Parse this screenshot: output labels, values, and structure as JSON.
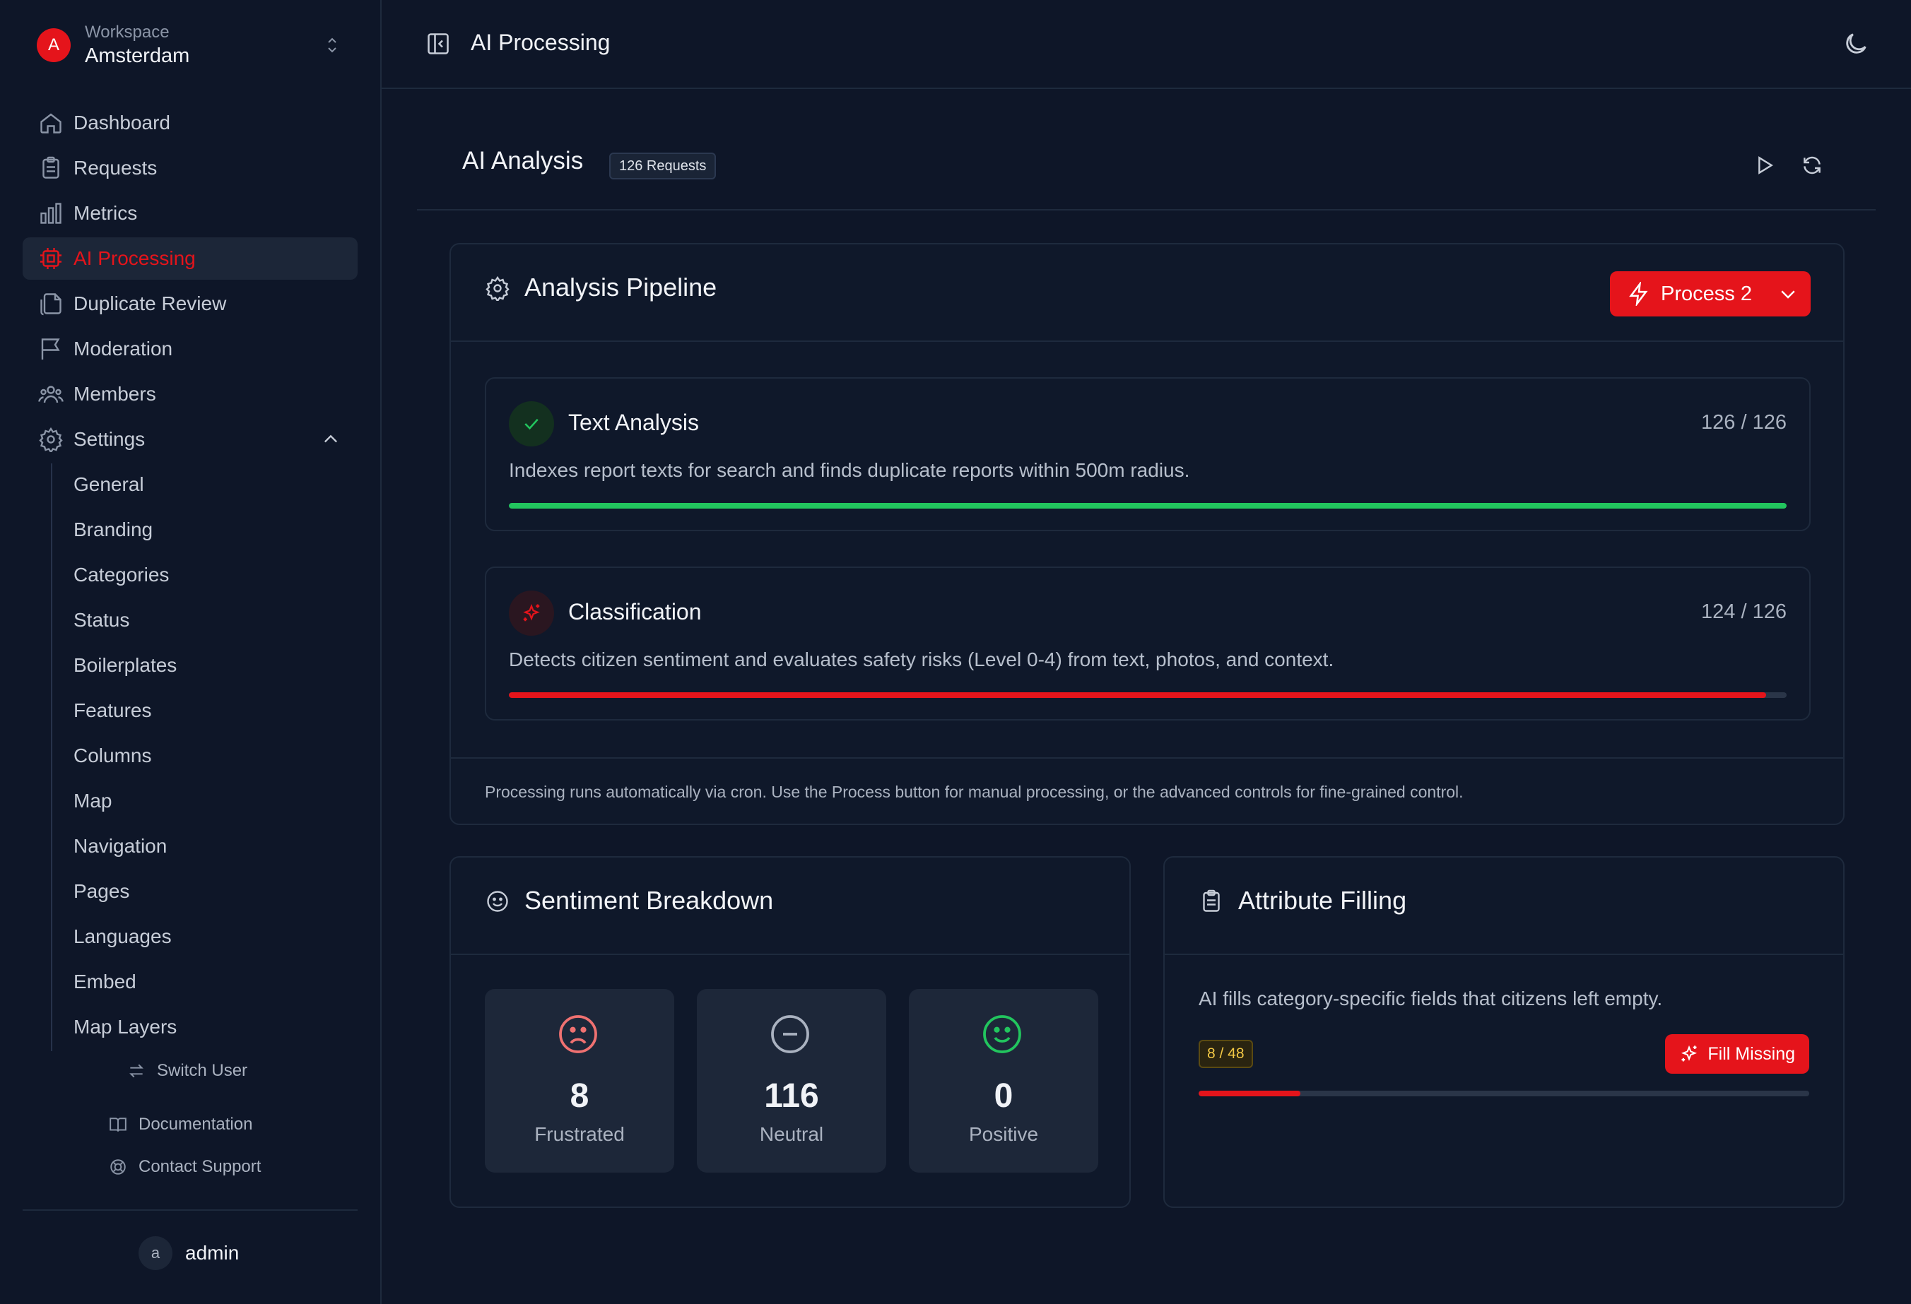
{
  "workspace": {
    "label": "Workspace",
    "name": "Amsterdam",
    "initial": "A"
  },
  "nav": {
    "dashboard": "Dashboard",
    "requests": "Requests",
    "metrics": "Metrics",
    "ai_processing": "AI Processing",
    "duplicate_review": "Duplicate Review",
    "moderation": "Moderation",
    "members": "Members",
    "settings": "Settings"
  },
  "settings_sub": [
    "General",
    "Branding",
    "Categories",
    "Status",
    "Boilerplates",
    "Features",
    "Columns",
    "Map",
    "Navigation",
    "Pages",
    "Languages",
    "Embed",
    "Map Layers"
  ],
  "sidebar_footer": {
    "switch_user": "Switch User",
    "documentation": "Documentation",
    "contact_support": "Contact Support",
    "user_initial": "a",
    "user_name": "admin"
  },
  "topbar": {
    "title": "AI Processing"
  },
  "page": {
    "title": "AI Analysis",
    "badge": "126 Requests"
  },
  "pipeline": {
    "title": "Analysis Pipeline",
    "process_button": "Process 2",
    "steps": [
      {
        "title": "Text Analysis",
        "count": "126 / 126",
        "progress": 1.0,
        "description": "Indexes report texts for search and finds duplicate reports within 500m radius."
      },
      {
        "title": "Classification",
        "count": "124 / 126",
        "progress": 0.984,
        "description": "Detects citizen sentiment and evaluates safety risks (Level 0-4) from text, photos, and context."
      }
    ],
    "footer": "Processing runs automatically via cron. Use the Process button for manual processing, or the advanced controls for fine-grained control."
  },
  "sentiment": {
    "title": "Sentiment Breakdown",
    "items": [
      {
        "value": "8",
        "label": "Frustrated"
      },
      {
        "value": "116",
        "label": "Neutral"
      },
      {
        "value": "0",
        "label": "Positive"
      }
    ]
  },
  "attributes": {
    "title": "Attribute Filling",
    "description": "AI fills category-specific fields that citizens left empty.",
    "badge": "8 / 48",
    "progress": 0.167,
    "button": "Fill Missing"
  },
  "colors": {
    "accent": "#e5141b",
    "success": "#22c55e",
    "bg": "#0e1628"
  }
}
